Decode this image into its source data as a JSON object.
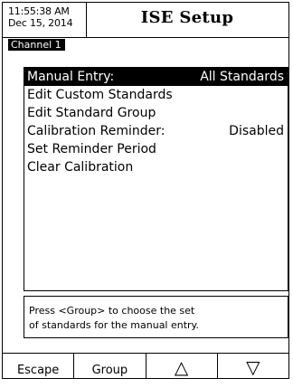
{
  "header": {
    "time": "11:55:38 AM",
    "date": "Dec 15, 2014",
    "title": "ISE Setup",
    "channel": "Channel 1"
  },
  "menu": {
    "items": [
      {
        "label": "Manual Entry:",
        "value": "All Standards",
        "selected": true
      },
      {
        "label": "Edit Custom Standards",
        "value": ""
      },
      {
        "label": "Edit Standard Group",
        "value": ""
      },
      {
        "label": "Calibration Reminder:",
        "value": "Disabled"
      },
      {
        "label": "Set Reminder Period",
        "value": ""
      },
      {
        "label": "Clear Calibration",
        "value": ""
      }
    ]
  },
  "hint": {
    "line1": "Press <Group> to choose the set",
    "line2": "of standards for the manual entry."
  },
  "softkeys": {
    "escape": "Escape",
    "group": "Group",
    "up": "△",
    "down": "▽"
  }
}
